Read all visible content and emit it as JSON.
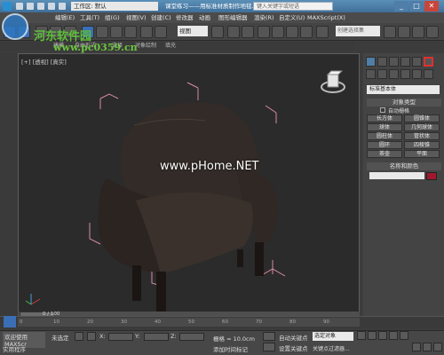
{
  "app": {
    "workspace_label": "工作区: 默认",
    "doc_title": "课堂练习——用标准材质制作地毯...",
    "search_placeholder": "键入关键字或短语",
    "window_controls": [
      "_",
      "□",
      "✕"
    ]
  },
  "menu": {
    "items": [
      "编辑(E)",
      "工具(T)",
      "组(G)",
      "视图(V)",
      "创建(C)",
      "修改器",
      "动画",
      "图形编辑器",
      "渲染(R)",
      "自定义(U)",
      "MAXScript(X)"
    ]
  },
  "toolbar": {
    "view_select": "视图",
    "selection_set_placeholder": "创建选择集"
  },
  "ribbon": {
    "items": [
      "建模",
      "自由形式",
      "选择",
      "对象绘制",
      "填充"
    ]
  },
  "viewport": {
    "label": "[+] [透视] [真实]"
  },
  "command_panel": {
    "category_dropdown": "标准基本体",
    "object_type_title": "对象类型",
    "autogrid_label": "自动栅格",
    "buttons": [
      "长方体",
      "圆锥体",
      "球体",
      "几何球体",
      "圆柱体",
      "管状体",
      "圆环",
      "四棱锥",
      "茶壶",
      "平面"
    ],
    "name_color_title": "名称和颜色",
    "swatch_color": "#a01830"
  },
  "timeline": {
    "frame_counter": "0 / 100",
    "ticks": [
      "0",
      "10",
      "20",
      "30",
      "40",
      "50",
      "60",
      "70",
      "80",
      "90"
    ]
  },
  "status": {
    "welcome": "欢迎使用 MAXScr",
    "realtime_label": "实用程序",
    "selected_label": "未选定",
    "coord_x_label": "X:",
    "coord_y_label": "Y:",
    "coord_z_label": "Z:",
    "grid_label": "栅格 = 10.0cm",
    "add_time_tag": "添加时间标记",
    "auto_key_label": "自动关键点",
    "set_key_label": "设置关键点",
    "key_filter_label": "关键点过滤器...",
    "selected_object_dropdown": "选定对象"
  },
  "watermark": {
    "site1": "河东软件园",
    "site2": "www.pc0359.cn",
    "site3": "www.pHome.NET"
  }
}
